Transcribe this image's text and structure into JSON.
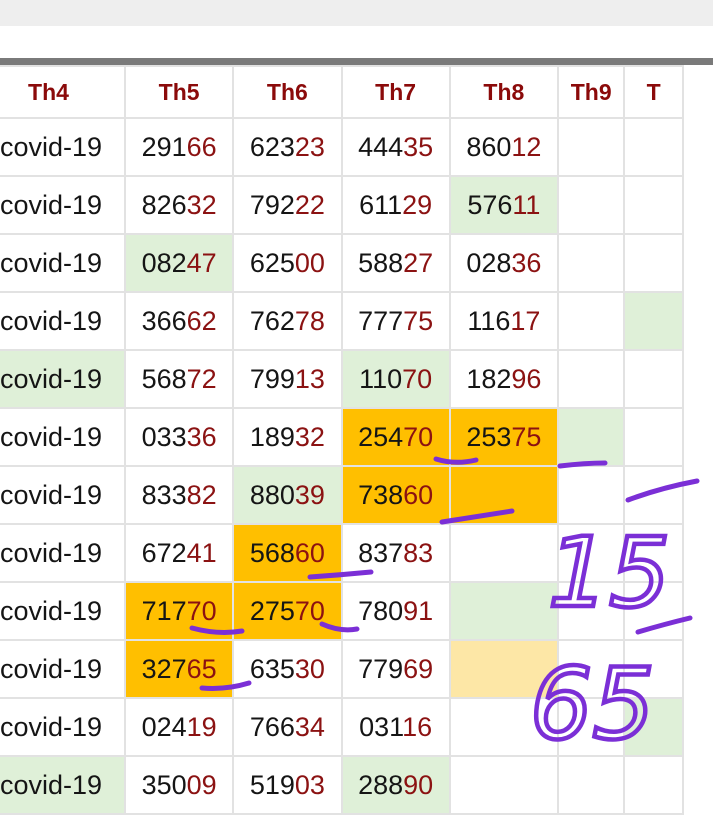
{
  "table": {
    "columns": [
      "Th4",
      "Th5",
      "Th6",
      "Th7",
      "Th8",
      "Th9",
      "T"
    ],
    "rows": [
      {
        "label": "covid-19",
        "label_green": false,
        "cells": [
          {
            "head": "291",
            "tail": "66",
            "bg": ""
          },
          {
            "head": "623",
            "tail": "23",
            "bg": ""
          },
          {
            "head": "444",
            "tail": "35",
            "bg": ""
          },
          {
            "head": "860",
            "tail": "12",
            "bg": ""
          },
          {
            "head": "",
            "tail": "",
            "bg": ""
          },
          {
            "head": "",
            "tail": "",
            "bg": ""
          }
        ]
      },
      {
        "label": "covid-19",
        "label_green": false,
        "cells": [
          {
            "head": "826",
            "tail": "32",
            "bg": ""
          },
          {
            "head": "792",
            "tail": "22",
            "bg": ""
          },
          {
            "head": "611",
            "tail": "29",
            "bg": ""
          },
          {
            "head": "576",
            "tail": "11",
            "bg": "green"
          },
          {
            "head": "",
            "tail": "",
            "bg": ""
          },
          {
            "head": "",
            "tail": "",
            "bg": ""
          }
        ]
      },
      {
        "label": "covid-19",
        "label_green": false,
        "cells": [
          {
            "head": "082",
            "tail": "47",
            "bg": "green"
          },
          {
            "head": "625",
            "tail": "00",
            "bg": ""
          },
          {
            "head": "588",
            "tail": "27",
            "bg": ""
          },
          {
            "head": "028",
            "tail": "36",
            "bg": ""
          },
          {
            "head": "",
            "tail": "",
            "bg": ""
          },
          {
            "head": "",
            "tail": "",
            "bg": ""
          }
        ]
      },
      {
        "label": "covid-19",
        "label_green": false,
        "cells": [
          {
            "head": "366",
            "tail": "62",
            "bg": ""
          },
          {
            "head": "762",
            "tail": "78",
            "bg": ""
          },
          {
            "head": "777",
            "tail": "75",
            "bg": ""
          },
          {
            "head": "116",
            "tail": "17",
            "bg": ""
          },
          {
            "head": "",
            "tail": "",
            "bg": ""
          },
          {
            "head": "",
            "tail": "",
            "bg": "green"
          }
        ]
      },
      {
        "label": "covid-19",
        "label_green": true,
        "cells": [
          {
            "head": "568",
            "tail": "72",
            "bg": ""
          },
          {
            "head": "799",
            "tail": "13",
            "bg": ""
          },
          {
            "head": "110",
            "tail": "70",
            "bg": "green"
          },
          {
            "head": "182",
            "tail": "96",
            "bg": ""
          },
          {
            "head": "",
            "tail": "",
            "bg": ""
          },
          {
            "head": "",
            "tail": "",
            "bg": ""
          }
        ]
      },
      {
        "label": "covid-19",
        "label_green": false,
        "cells": [
          {
            "head": "033",
            "tail": "36",
            "bg": ""
          },
          {
            "head": "189",
            "tail": "32",
            "bg": ""
          },
          {
            "head": "254",
            "tail": "70",
            "bg": "orange"
          },
          {
            "head": "253",
            "tail": "75",
            "bg": "orange"
          },
          {
            "head": "",
            "tail": "",
            "bg": "green"
          },
          {
            "head": "",
            "tail": "",
            "bg": ""
          }
        ]
      },
      {
        "label": "covid-19",
        "label_green": false,
        "cells": [
          {
            "head": "833",
            "tail": "82",
            "bg": ""
          },
          {
            "head": "880",
            "tail": "39",
            "bg": "green"
          },
          {
            "head": "738",
            "tail": "60",
            "bg": "orange"
          },
          {
            "head": "",
            "tail": "",
            "bg": "orange"
          },
          {
            "head": "",
            "tail": "",
            "bg": ""
          },
          {
            "head": "",
            "tail": "",
            "bg": ""
          }
        ]
      },
      {
        "label": "covid-19",
        "label_green": false,
        "cells": [
          {
            "head": "672",
            "tail": "41",
            "bg": ""
          },
          {
            "head": "568",
            "tail": "60",
            "bg": "orange"
          },
          {
            "head": "837",
            "tail": "83",
            "bg": ""
          },
          {
            "head": "",
            "tail": "",
            "bg": ""
          },
          {
            "head": "",
            "tail": "",
            "bg": ""
          },
          {
            "head": "",
            "tail": "",
            "bg": ""
          }
        ]
      },
      {
        "label": "covid-19",
        "label_green": false,
        "cells": [
          {
            "head": "717",
            "tail": "70",
            "bg": "orange"
          },
          {
            "head": "275",
            "tail": "70",
            "bg": "orange"
          },
          {
            "head": "780",
            "tail": "91",
            "bg": ""
          },
          {
            "head": "",
            "tail": "",
            "bg": "green"
          },
          {
            "head": "",
            "tail": "",
            "bg": ""
          },
          {
            "head": "",
            "tail": "",
            "bg": ""
          }
        ]
      },
      {
        "label": "covid-19",
        "label_green": false,
        "cells": [
          {
            "head": "327",
            "tail": "65",
            "bg": "orange"
          },
          {
            "head": "635",
            "tail": "30",
            "bg": ""
          },
          {
            "head": "779",
            "tail": "69",
            "bg": ""
          },
          {
            "head": "",
            "tail": "",
            "bg": "pale"
          },
          {
            "head": "",
            "tail": "",
            "bg": ""
          },
          {
            "head": "",
            "tail": "",
            "bg": ""
          }
        ]
      },
      {
        "label": "covid-19",
        "label_green": false,
        "cells": [
          {
            "head": "024",
            "tail": "19",
            "bg": ""
          },
          {
            "head": "766",
            "tail": "34",
            "bg": ""
          },
          {
            "head": "031",
            "tail": "16",
            "bg": ""
          },
          {
            "head": "",
            "tail": "",
            "bg": ""
          },
          {
            "head": "",
            "tail": "",
            "bg": ""
          },
          {
            "head": "",
            "tail": "",
            "bg": "green"
          }
        ]
      },
      {
        "label": "covid-19",
        "label_green": true,
        "cells": [
          {
            "head": "350",
            "tail": "09",
            "bg": ""
          },
          {
            "head": "519",
            "tail": "03",
            "bg": ""
          },
          {
            "head": "288",
            "tail": "90",
            "bg": "green"
          },
          {
            "head": "",
            "tail": "",
            "bg": ""
          },
          {
            "head": "",
            "tail": "",
            "bg": ""
          },
          {
            "head": "",
            "tail": "",
            "bg": ""
          }
        ]
      }
    ]
  },
  "handwriting": {
    "first": "15",
    "second": "65",
    "ink_color": "#7b2fd6"
  },
  "colors": {
    "header_text": "#8b0a0a",
    "tail_digits": "#8b1212",
    "highlight_orange": "#ffbf00",
    "highlight_green": "#dff0d8",
    "highlight_pale": "#fde7a6"
  }
}
